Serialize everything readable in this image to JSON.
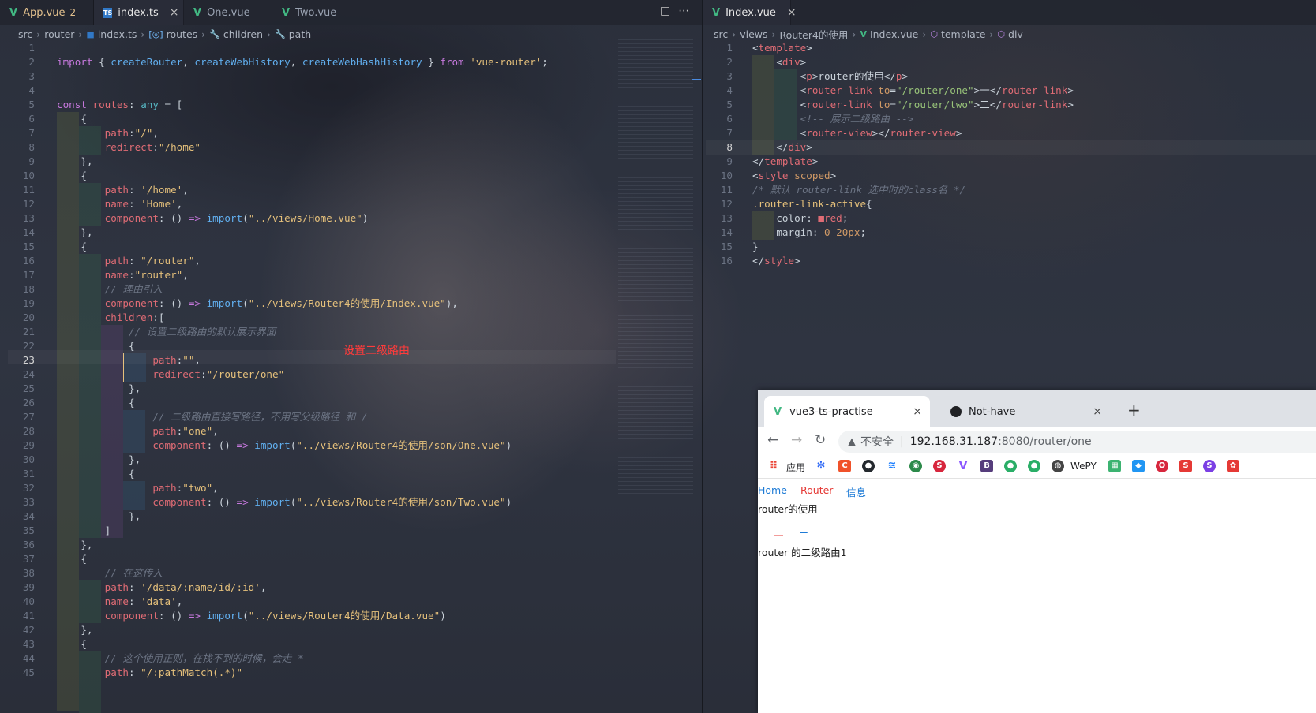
{
  "left_editor": {
    "tabs": [
      {
        "label": "App.vue",
        "badge": "2",
        "icon": "vue-icon"
      },
      {
        "label": "index.ts",
        "close": "×",
        "icon": "ts-icon"
      },
      {
        "label": "One.vue",
        "icon": "vue-icon"
      },
      {
        "label": "Two.vue",
        "icon": "vue-icon"
      }
    ],
    "breadcrumbs": [
      "src",
      "router",
      "index.ts",
      "routes",
      "children",
      "path"
    ],
    "annotation": "设置二级路由",
    "current_line": 23,
    "lines": [
      [],
      [
        [
          "kw",
          "import"
        ],
        [
          "pun",
          " { "
        ],
        [
          "fn",
          "createRouter"
        ],
        [
          "pun",
          ", "
        ],
        [
          "fn",
          "createWebHistory"
        ],
        [
          "pun",
          ", "
        ],
        [
          "fn",
          "createWebHashHistory"
        ],
        [
          "pun",
          " } "
        ],
        [
          "kw",
          "from"
        ],
        [
          "pun",
          " "
        ],
        [
          "str",
          "'vue-router'"
        ],
        [
          "pun",
          ";"
        ]
      ],
      [],
      [],
      [
        [
          "kw",
          "const"
        ],
        [
          "pun",
          " "
        ],
        [
          "key",
          "routes"
        ],
        [
          "pun",
          ": "
        ],
        [
          "typ",
          "any"
        ],
        [
          "pun",
          " = ["
        ]
      ],
      [
        [
          "pun",
          "    {"
        ]
      ],
      [
        [
          "key",
          "        path"
        ],
        [
          "pun",
          ":"
        ],
        [
          "str",
          "\"/\""
        ],
        [
          "pun",
          ","
        ]
      ],
      [
        [
          "key",
          "        redirect"
        ],
        [
          "pun",
          ":"
        ],
        [
          "str",
          "\"/home\""
        ]
      ],
      [
        [
          "pun",
          "    },"
        ]
      ],
      [
        [
          "pun",
          "    {"
        ]
      ],
      [
        [
          "key",
          "        path"
        ],
        [
          "pun",
          ": "
        ],
        [
          "str",
          "'/home'"
        ],
        [
          "pun",
          ","
        ]
      ],
      [
        [
          "key",
          "        name"
        ],
        [
          "pun",
          ": "
        ],
        [
          "str",
          "'Home'"
        ],
        [
          "pun",
          ","
        ]
      ],
      [
        [
          "key",
          "        component"
        ],
        [
          "pun",
          ": () "
        ],
        [
          "kw",
          "=>"
        ],
        [
          "pun",
          " "
        ],
        [
          "fn",
          "import"
        ],
        [
          "pun",
          "("
        ],
        [
          "str",
          "\"../views/Home.vue\""
        ],
        [
          "pun",
          ")"
        ]
      ],
      [
        [
          "pun",
          "    },"
        ]
      ],
      [
        [
          "pun",
          "    {"
        ]
      ],
      [
        [
          "key",
          "        path"
        ],
        [
          "pun",
          ": "
        ],
        [
          "str",
          "\"/router\""
        ],
        [
          "pun",
          ","
        ]
      ],
      [
        [
          "key",
          "        name"
        ],
        [
          "pun",
          ":"
        ],
        [
          "str",
          "\"router\""
        ],
        [
          "pun",
          ","
        ]
      ],
      [
        [
          "cmt",
          "        // 理由引入"
        ]
      ],
      [
        [
          "key",
          "        component"
        ],
        [
          "pun",
          ": () "
        ],
        [
          "kw",
          "=>"
        ],
        [
          "pun",
          " "
        ],
        [
          "fn",
          "import"
        ],
        [
          "pun",
          "("
        ],
        [
          "str",
          "\"../views/Router4的使用/Index.vue\""
        ],
        [
          "pun",
          "),"
        ]
      ],
      [
        [
          "key",
          "        children"
        ],
        [
          "pun",
          ":["
        ]
      ],
      [
        [
          "cmt",
          "            // 设置二级路由的默认展示界面"
        ]
      ],
      [
        [
          "pun",
          "            {"
        ]
      ],
      [
        [
          "key",
          "                path"
        ],
        [
          "pun",
          ":"
        ],
        [
          "str",
          "\"\""
        ],
        [
          "pun",
          ","
        ]
      ],
      [
        [
          "key",
          "                redirect"
        ],
        [
          "pun",
          ":"
        ],
        [
          "str",
          "\"/router/one\""
        ]
      ],
      [
        [
          "pun",
          "            },"
        ]
      ],
      [
        [
          "pun",
          "            {"
        ]
      ],
      [
        [
          "cmt",
          "                // 二级路由直接写路径，不用写父级路径 和 /"
        ]
      ],
      [
        [
          "key",
          "                path"
        ],
        [
          "pun",
          ":"
        ],
        [
          "str",
          "\"one\""
        ],
        [
          "pun",
          ","
        ]
      ],
      [
        [
          "key",
          "                component"
        ],
        [
          "pun",
          ": () "
        ],
        [
          "kw",
          "=>"
        ],
        [
          "pun",
          " "
        ],
        [
          "fn",
          "import"
        ],
        [
          "pun",
          "("
        ],
        [
          "str",
          "\"../views/Router4的使用/son/One.vue\""
        ],
        [
          "pun",
          ")"
        ]
      ],
      [
        [
          "pun",
          "            },"
        ]
      ],
      [
        [
          "pun",
          "            {"
        ]
      ],
      [
        [
          "key",
          "                path"
        ],
        [
          "pun",
          ":"
        ],
        [
          "str",
          "\"two\""
        ],
        [
          "pun",
          ","
        ]
      ],
      [
        [
          "key",
          "                component"
        ],
        [
          "pun",
          ": () "
        ],
        [
          "kw",
          "=>"
        ],
        [
          "pun",
          " "
        ],
        [
          "fn",
          "import"
        ],
        [
          "pun",
          "("
        ],
        [
          "str",
          "\"../views/Router4的使用/son/Two.vue\""
        ],
        [
          "pun",
          ")"
        ]
      ],
      [
        [
          "pun",
          "            },"
        ]
      ],
      [
        [
          "pun",
          "        ]"
        ]
      ],
      [
        [
          "pun",
          "    },"
        ]
      ],
      [
        [
          "pun",
          "    {"
        ]
      ],
      [
        [
          "cmt",
          "        // 在这传入"
        ]
      ],
      [
        [
          "key",
          "        path"
        ],
        [
          "pun",
          ": "
        ],
        [
          "str",
          "'/data/:name/id/:id'"
        ],
        [
          "pun",
          ","
        ]
      ],
      [
        [
          "key",
          "        name"
        ],
        [
          "pun",
          ": "
        ],
        [
          "str",
          "'data'"
        ],
        [
          "pun",
          ","
        ]
      ],
      [
        [
          "key",
          "        component"
        ],
        [
          "pun",
          ": () "
        ],
        [
          "kw",
          "=>"
        ],
        [
          "pun",
          " "
        ],
        [
          "fn",
          "import"
        ],
        [
          "pun",
          "("
        ],
        [
          "str",
          "\"../views/Router4的使用/Data.vue\""
        ],
        [
          "pun",
          ")"
        ]
      ],
      [
        [
          "pun",
          "    },"
        ]
      ],
      [
        [
          "pun",
          "    {"
        ]
      ],
      [
        [
          "cmt",
          "        // 这个使用正则，在找不到的时候，会走 *"
        ]
      ],
      [
        [
          "key",
          "        path"
        ],
        [
          "pun",
          ": "
        ],
        [
          "str",
          "\"/:pathMatch(.*)\""
        ]
      ]
    ]
  },
  "right_editor": {
    "tab": {
      "label": "Index.vue",
      "close": "×",
      "icon": "vue-icon"
    },
    "breadcrumbs": [
      "src",
      "views",
      "Router4的使用",
      "Index.vue",
      "template",
      "div"
    ],
    "current_line": 8,
    "lines": [
      [
        [
          "pun",
          "<"
        ],
        [
          "tag",
          "template"
        ],
        [
          "pun",
          ">"
        ]
      ],
      [
        [
          "pun",
          "    <"
        ],
        [
          "tag",
          "div"
        ],
        [
          "pun",
          ">"
        ]
      ],
      [
        [
          "pun",
          "        <"
        ],
        [
          "tag",
          "p"
        ],
        [
          "pun",
          ">router的使用</"
        ],
        [
          "tag",
          "p"
        ],
        [
          "pun",
          ">"
        ]
      ],
      [
        [
          "pun",
          "        <"
        ],
        [
          "tag",
          "router-link"
        ],
        [
          "pun",
          " "
        ],
        [
          "attr",
          "to"
        ],
        [
          "pun",
          "="
        ],
        [
          "tstr",
          "\"/router/one\""
        ],
        [
          "pun",
          ">一</"
        ],
        [
          "tag",
          "router-link"
        ],
        [
          "pun",
          ">"
        ]
      ],
      [
        [
          "pun",
          "        <"
        ],
        [
          "tag",
          "router-link"
        ],
        [
          "pun",
          " "
        ],
        [
          "attr",
          "to"
        ],
        [
          "pun",
          "="
        ],
        [
          "tstr",
          "\"/router/two\""
        ],
        [
          "pun",
          ">二</"
        ],
        [
          "tag",
          "router-link"
        ],
        [
          "pun",
          ">"
        ]
      ],
      [
        [
          "cmt",
          "        <!-- 展示二级路由 -->"
        ]
      ],
      [
        [
          "pun",
          "        <"
        ],
        [
          "tag",
          "router-view"
        ],
        [
          "pun",
          "></"
        ],
        [
          "tag",
          "router-view"
        ],
        [
          "pun",
          ">"
        ]
      ],
      [
        [
          "pun",
          "    </"
        ],
        [
          "tag",
          "div"
        ],
        [
          "pun",
          ">"
        ]
      ],
      [
        [
          "pun",
          "</"
        ],
        [
          "tag",
          "template"
        ],
        [
          "pun",
          ">"
        ]
      ],
      [
        [
          "pun",
          "<"
        ],
        [
          "tag",
          "style"
        ],
        [
          "pun",
          " "
        ],
        [
          "attr",
          "scoped"
        ],
        [
          "pun",
          ">"
        ]
      ],
      [
        [
          "cmt",
          "/* 默认 router-link 选中时的class名 */"
        ]
      ],
      [
        [
          "sel",
          ".router-link-active"
        ],
        [
          "pun",
          "{"
        ]
      ],
      [
        [
          "pun",
          "    color: "
        ],
        [
          "key",
          "■red"
        ],
        [
          "pun",
          ";"
        ]
      ],
      [
        [
          "pun",
          "    margin: "
        ],
        [
          "attr",
          "0 20px"
        ],
        [
          "pun",
          ";"
        ]
      ],
      [
        [
          "pun",
          "}"
        ]
      ],
      [
        [
          "pun",
          "</"
        ],
        [
          "tag",
          "style"
        ],
        [
          "pun",
          ">"
        ]
      ]
    ]
  },
  "browser": {
    "tabs": [
      {
        "label": "vue3-ts-practise",
        "close": "×"
      },
      {
        "label": "Not-have",
        "close": "×"
      }
    ],
    "new_tab": "+",
    "security_label": "不安全",
    "url_host": "192.168.31.187",
    "url_path": ":8080/router/one",
    "bookmarks": {
      "apps_label": "应用",
      "wepy_label": "WePY"
    },
    "page": {
      "nav_links": [
        "Home",
        "Router",
        "信息"
      ],
      "heading": "router的使用",
      "sub_links": [
        "一",
        "二"
      ],
      "content": "router 的二级路由1"
    }
  }
}
